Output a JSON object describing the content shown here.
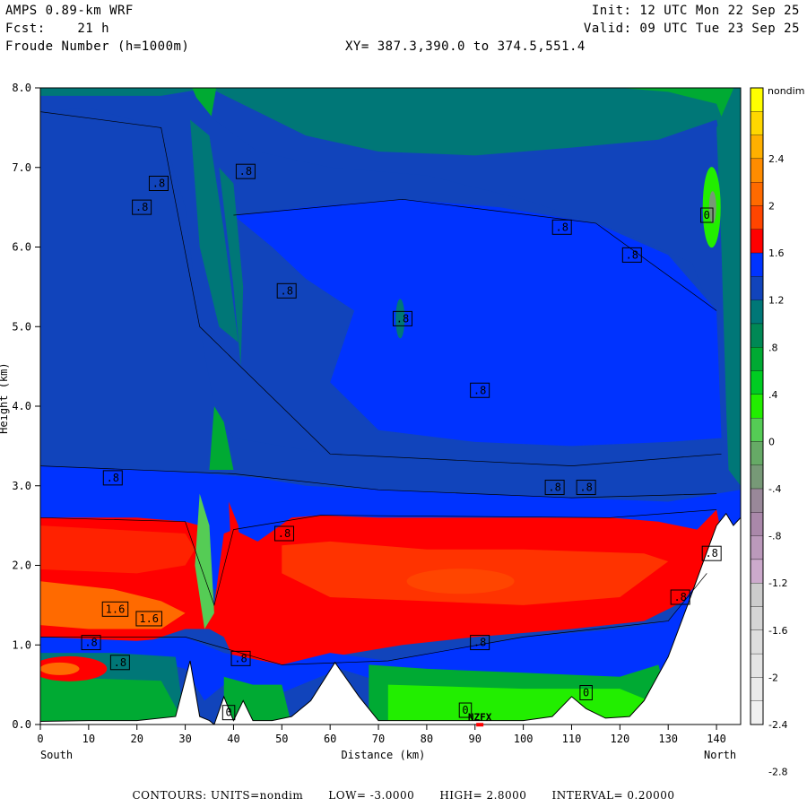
{
  "header": {
    "model": "AMPS 0.89-km WRF",
    "forecast": "Fcst:    21 h",
    "field": "Froude Number (h=1000m)",
    "init": "Init: 12 UTC Mon 22 Sep 25",
    "valid": "Valid: 09 UTC Tue 23 Sep 25",
    "cross_section": "XY= 387.3,390.0 to 374.5,551.4"
  },
  "footer": {
    "contours": "CONTOURS:  UNITS=nondim",
    "low": "LOW= -3.0000",
    "high": "HIGH=  2.8000",
    "interval": "INTERVAL=  0.20000"
  },
  "station": "NZFX",
  "chart_data": {
    "type": "heatmap",
    "title": "Froude Number (h=1000m)",
    "xlabel": "Distance (km)",
    "ylabel": "Height (km)",
    "xlim": [
      0,
      145
    ],
    "ylim": [
      0,
      8
    ],
    "x_ticks": [
      "0",
      "10",
      "20",
      "30",
      "40",
      "50",
      "60",
      "70",
      "80",
      "90",
      "100",
      "110",
      "120",
      "130",
      "140"
    ],
    "y_ticks": [
      "0.0",
      "1.0",
      "2.0",
      "3.0",
      "4.0",
      "5.0",
      "6.0",
      "7.0",
      "8.0"
    ],
    "x_end_labels": {
      "left": "South",
      "right": "North"
    },
    "colorbar": {
      "units": "nondim",
      "labels": [
        "2.4",
        "2",
        "1.6",
        "1.2",
        ".8",
        ".4",
        "0",
        "-.4",
        "-.8",
        "-1.2",
        "-1.6",
        "-2",
        "-2.4",
        "-2.8"
      ],
      "colors": [
        "#ffff00",
        "#ffd700",
        "#ffb000",
        "#ff8c00",
        "#ff6a00",
        "#ff4500",
        "#ff0000",
        "#0033ff",
        "#1144bb",
        "#007777",
        "#008855",
        "#00aa33",
        "#00cc22",
        "#22ee00",
        "#55cc55",
        "#66aa66",
        "#779977",
        "#998899",
        "#aa88aa",
        "#bb99bb",
        "#ccaacc",
        "#cccccc",
        "#d5d5d5",
        "#dddddd",
        "#e4e4e4",
        "#eaeaea",
        "#f0f0f0"
      ]
    },
    "contour_labels": [
      {
        "x": 24.5,
        "y": 6.8,
        "text": ".8"
      },
      {
        "x": 21,
        "y": 6.5,
        "text": ".8"
      },
      {
        "x": 42.5,
        "y": 6.95,
        "text": ".8"
      },
      {
        "x": 51,
        "y": 5.45,
        "text": ".8"
      },
      {
        "x": 75,
        "y": 5.1,
        "text": ".8"
      },
      {
        "x": 108,
        "y": 6.25,
        "text": ".8"
      },
      {
        "x": 122.5,
        "y": 5.9,
        "text": ".8"
      },
      {
        "x": 138,
        "y": 6.4,
        "text": "0"
      },
      {
        "x": 91,
        "y": 4.2,
        "text": ".8"
      },
      {
        "x": 15,
        "y": 3.1,
        "text": ".8"
      },
      {
        "x": 106.5,
        "y": 2.98,
        "text": ".8"
      },
      {
        "x": 113,
        "y": 2.98,
        "text": ".8"
      },
      {
        "x": 50.5,
        "y": 2.4,
        "text": ".8"
      },
      {
        "x": 139,
        "y": 2.15,
        "text": ".8"
      },
      {
        "x": 132.5,
        "y": 1.6,
        "text": ".8"
      },
      {
        "x": 15.5,
        "y": 1.45,
        "text": "1.6"
      },
      {
        "x": 22.5,
        "y": 1.33,
        "text": "1.6"
      },
      {
        "x": 10.5,
        "y": 1.03,
        "text": ".8"
      },
      {
        "x": 16.5,
        "y": 0.78,
        "text": ".8"
      },
      {
        "x": 41.5,
        "y": 0.83,
        "text": ".8"
      },
      {
        "x": 91,
        "y": 1.03,
        "text": ".8"
      },
      {
        "x": 113,
        "y": 0.4,
        "text": "0"
      },
      {
        "x": 39,
        "y": 0.15,
        "text": "0"
      },
      {
        "x": 88,
        "y": 0.18,
        "text": "0"
      }
    ],
    "terrain_km": [
      [
        0,
        0.04
      ],
      [
        10,
        0.05
      ],
      [
        20,
        0.05
      ],
      [
        28,
        0.1
      ],
      [
        31,
        0.8
      ],
      [
        33,
        0.1
      ],
      [
        35,
        0.05
      ],
      [
        36,
        0.0
      ],
      [
        38,
        0.35
      ],
      [
        40,
        0.05
      ],
      [
        42,
        0.3
      ],
      [
        44,
        0.05
      ],
      [
        48,
        0.05
      ],
      [
        52,
        0.1
      ],
      [
        56,
        0.3
      ],
      [
        61,
        0.78
      ],
      [
        66,
        0.35
      ],
      [
        70,
        0.05
      ],
      [
        80,
        0.05
      ],
      [
        90,
        0.05
      ],
      [
        100,
        0.05
      ],
      [
        106,
        0.1
      ],
      [
        110,
        0.35
      ],
      [
        113,
        0.2
      ],
      [
        117,
        0.08
      ],
      [
        122,
        0.1
      ],
      [
        125,
        0.3
      ],
      [
        130,
        0.85
      ],
      [
        134,
        1.5
      ],
      [
        137,
        2.0
      ],
      [
        140,
        2.5
      ],
      [
        142,
        2.65
      ],
      [
        143.5,
        2.5
      ],
      [
        145,
        2.6
      ]
    ],
    "regions": [
      {
        "name": "upper-green-dark",
        "value": 0.6,
        "color": "#007777"
      },
      {
        "name": "mid-blue",
        "value": 0.8,
        "color": "#1144bb"
      },
      {
        "name": "lower-red",
        "value": 1.2,
        "color": "#ff0000"
      },
      {
        "name": "boundary-green",
        "value": 0.2,
        "color": "#00cc22"
      }
    ],
    "grid": false,
    "legend": "right"
  }
}
